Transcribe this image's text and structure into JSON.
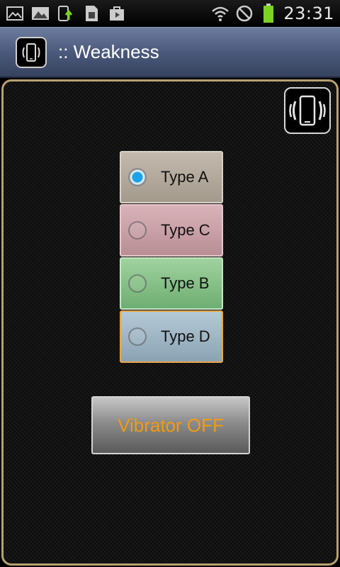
{
  "status_bar": {
    "time": "23:31",
    "left_icons": [
      "gallery-icon",
      "image-icon",
      "upload-icon",
      "sim-icon",
      "bag-icon"
    ],
    "right_icons": [
      "wifi-icon",
      "blocked-icon",
      "battery-icon"
    ],
    "battery_color": "#7dd321"
  },
  "title_bar": {
    "title": ":: Weakness",
    "icon": "vibrate-phone-icon"
  },
  "panel": {
    "corner_icon": "vibrate-phone-icon",
    "options": [
      {
        "label": "Type A",
        "selected": true,
        "color": "#b3aa9c"
      },
      {
        "label": "Type C",
        "selected": false,
        "color": "#c99ea5"
      },
      {
        "label": "Type B",
        "selected": false,
        "color": "#86c088"
      },
      {
        "label": "Type D",
        "selected": false,
        "color": "#9fb6c5"
      }
    ],
    "vibrator_button": "Vibrator OFF",
    "accent_color": "#f29a14",
    "border_color": "#b8a070"
  }
}
